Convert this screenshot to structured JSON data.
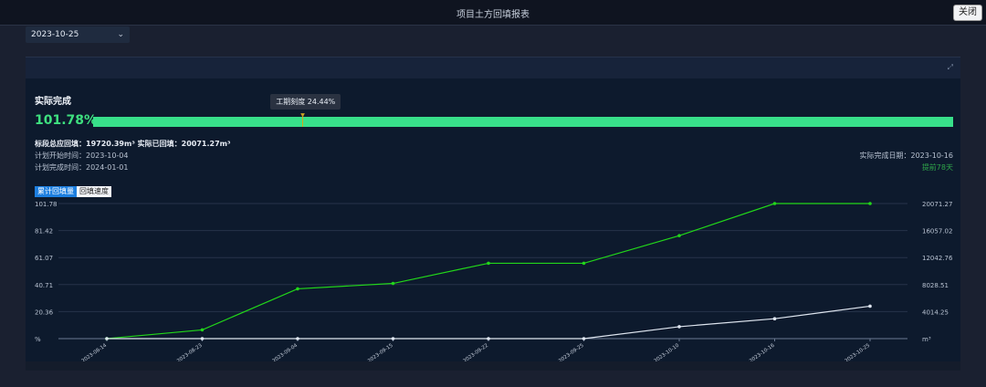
{
  "window": {
    "title": "项目土方回填报表",
    "close_label": "关闭"
  },
  "date_select": {
    "value": "2023-10-25"
  },
  "summary": {
    "heading": "实际完成",
    "percent": "101.78%",
    "progress_fraction": 1.0,
    "marker_fraction": 0.2444,
    "tooltip": "工期刻度 24.44%",
    "totals_line": "标段总应回填：19720.39m³   实际已回填：20071.27m³",
    "plan_start": "计划开始时间：2023-10-04",
    "plan_end": "计划完成时间：2024-01-01",
    "actual_finish": "实际完成日期：2023-10-16",
    "ahead": "提前78天"
  },
  "tabs": [
    {
      "label": "累计回填量"
    },
    {
      "label": "回填速度"
    }
  ],
  "colors": {
    "accent_green": "#3ee07f",
    "series_green": "#22d61a",
    "series_white": "#dfe6f0",
    "tab_blue": "#1d7fe0"
  },
  "chart_data": {
    "type": "line",
    "x": [
      "2023-08-14",
      "2023-08-23",
      "2023-09-04",
      "2023-09-15",
      "2023-09-22",
      "2023-09-25",
      "2023-10-10",
      "2023-10-16",
      "2023-10-25"
    ],
    "left_ticks": [
      "%",
      "20.36",
      "40.71",
      "61.07",
      "81.42",
      "101.78"
    ],
    "right_ticks": [
      "m³",
      "4014.25",
      "8028.51",
      "12042.76",
      "16057.02",
      "20071.27"
    ],
    "ylim_left": [
      0,
      101.78
    ],
    "ylim_right": [
      0,
      20071.27
    ],
    "series": [
      {
        "axis": "right",
        "color": "#22d61a",
        "values": [
          0,
          1300,
          7400,
          8200,
          11200,
          11200,
          15300,
          20071.27,
          20071.27
        ]
      },
      {
        "axis": "left",
        "color": "#dfe6f0",
        "values": [
          0,
          0,
          0,
          0,
          0,
          0,
          9,
          15,
          24.44
        ]
      }
    ],
    "grid": true
  }
}
